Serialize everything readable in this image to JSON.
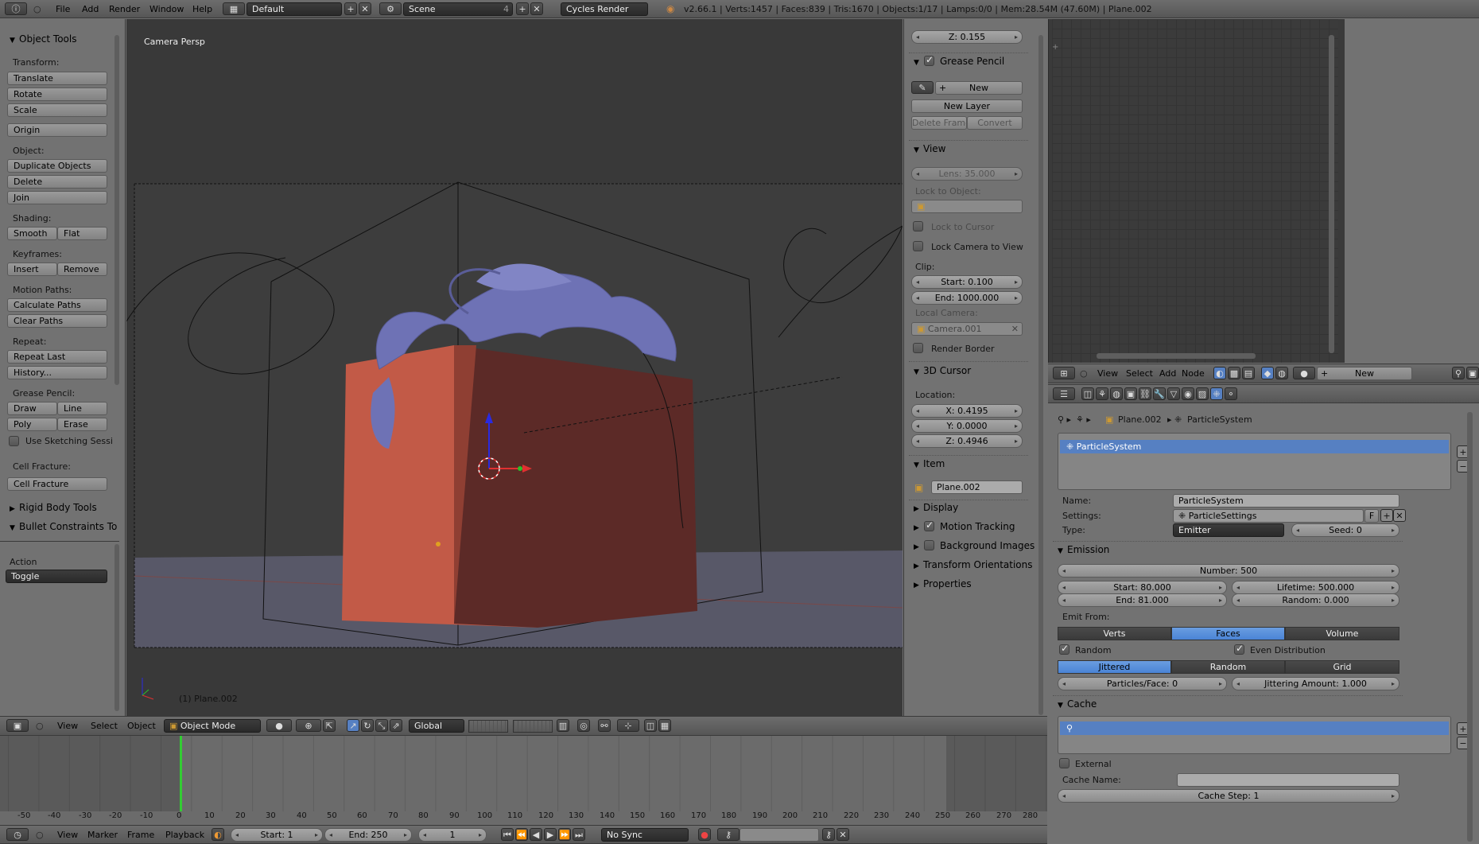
{
  "topbar": {
    "menus": [
      "File",
      "Add",
      "Render",
      "Window",
      "Help"
    ],
    "layout": "Default",
    "scene": "Scene",
    "scene_users": "4",
    "engine": "Cycles Render",
    "stats": "v2.66.1 | Verts:1457 | Faces:839 | Tris:1670 | Objects:1/17 | Lamps:0/0 | Mem:28.54M (47.60M) | Plane.002"
  },
  "toolshelf": {
    "title": "Object Tools",
    "transform_label": "Transform:",
    "translate": "Translate",
    "rotate": "Rotate",
    "scale": "Scale",
    "origin": "Origin",
    "object_label": "Object:",
    "duplicate": "Duplicate Objects",
    "delete": "Delete",
    "join": "Join",
    "shading_label": "Shading:",
    "smooth": "Smooth",
    "flat": "Flat",
    "keyframes_label": "Keyframes:",
    "insert": "Insert",
    "remove": "Remove",
    "motion_label": "Motion Paths:",
    "calc_paths": "Calculate Paths",
    "clear_paths": "Clear Paths",
    "repeat_label": "Repeat:",
    "repeat_last": "Repeat Last",
    "history": "History...",
    "gp_label": "Grease Pencil:",
    "draw": "Draw",
    "line": "Line",
    "poly": "Poly",
    "erase": "Erase",
    "sketching": "Use Sketching Sessi",
    "cellfrac_label": "Cell Fracture:",
    "cellfrac": "Cell Fracture",
    "rigid": "Rigid Body Tools",
    "bullet": "Bullet Constraints To",
    "action_label": "Action",
    "action_value": "Toggle"
  },
  "viewport": {
    "label": "Camera Persp",
    "object": "(1) Plane.002"
  },
  "npanel": {
    "z_top": "Z: 0.155",
    "grease_pencil": "Grease Pencil",
    "gp_new": "New",
    "new_layer": "New Layer",
    "delete_frame": "Delete Frame",
    "convert": "Convert",
    "view": "View",
    "lens": "Lens: 35.000",
    "lock_object": "Lock to Object:",
    "lock_cursor": "Lock to Cursor",
    "lock_camera": "Lock Camera to View",
    "clip": "Clip:",
    "clip_start": "Start: 0.100",
    "clip_end": "End: 1000.000",
    "local_camera": "Local Camera:",
    "camera": "Camera.001",
    "render_border": "Render Border",
    "cursor3d": "3D Cursor",
    "location": "Location:",
    "cx": "X: 0.4195",
    "cy": "Y: 0.0000",
    "cz": "Z: 0.4946",
    "item": "Item",
    "item_name": "Plane.002",
    "display": "Display",
    "motion_tracking": "Motion Tracking",
    "bg_images": "Background Images",
    "transform_orient": "Transform Orientations",
    "properties": "Properties"
  },
  "viewheader": {
    "view": "View",
    "select": "Select",
    "object": "Object",
    "mode": "Object Mode",
    "orientation": "Global"
  },
  "nodeheader": {
    "view": "View",
    "select": "Select",
    "add": "Add",
    "node": "Node",
    "new": "New"
  },
  "props": {
    "breadcrumb_obj": "Plane.002",
    "breadcrumb_ps": "ParticleSystem",
    "list_item": "ParticleSystem",
    "name_label": "Name:",
    "name_value": "ParticleSystem",
    "settings_label": "Settings:",
    "settings_value": "ParticleSettings",
    "settings_f": "F",
    "type_label": "Type:",
    "type_value": "Emitter",
    "seed": "Seed: 0",
    "emission": "Emission",
    "number": "Number: 500",
    "start": "Start: 80.000",
    "end": "End: 81.000",
    "lifetime": "Lifetime: 500.000",
    "random_v": "Random: 0.000",
    "emit_from": "Emit From:",
    "verts": "Verts",
    "faces": "Faces",
    "volume": "Volume",
    "random_chk": "Random",
    "even": "Even Distribution",
    "jittered": "Jittered",
    "random_seg": "Random",
    "grid": "Grid",
    "ppf": "Particles/Face: 0",
    "jitter_amt": "Jittering Amount: 1.000",
    "cache": "Cache",
    "external": "External",
    "cache_name": "Cache Name:",
    "cache_step": "Cache Step: 1"
  },
  "timeline": {
    "ticks": [
      "-50",
      "-40",
      "-30",
      "-20",
      "-10",
      "0",
      "10",
      "20",
      "30",
      "40",
      "50",
      "60",
      "70",
      "80",
      "90",
      "100",
      "110",
      "120",
      "130",
      "140",
      "150",
      "160",
      "170",
      "180",
      "190",
      "200",
      "210",
      "220",
      "230",
      "240",
      "250",
      "260",
      "270",
      "280"
    ],
    "view": "View",
    "marker": "Marker",
    "frame": "Frame",
    "playback": "Playback",
    "start": "Start: 1",
    "end": "End: 250",
    "current": "1",
    "sync": "No Sync"
  }
}
